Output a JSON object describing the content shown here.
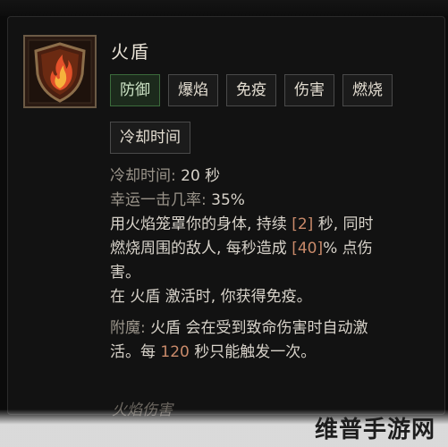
{
  "skill": {
    "name": "火盾",
    "tags": [
      "防御",
      "爆焰",
      "免疫",
      "伤害",
      "燃烧"
    ],
    "cooldown_tag": "冷却时间",
    "stats": {
      "cooldown_label": "冷却时间:",
      "cooldown_value": "20 秒",
      "lucky_label": "幸运一击几率:",
      "lucky_value": "35%"
    },
    "description": {
      "l1_a": "用火焰笼罩你的身体, 持续",
      "l1_b": "[2]",
      "l1_c": "秒, 同时",
      "l2_a": "燃烧周围的敌人, 每秒造成",
      "l2_b": "[40]",
      "l2_c": "% 点伤",
      "l3": "害。",
      "l4": "在 火盾 激活时, 你获得免疫。"
    },
    "enchant": {
      "label": "附魔:",
      "l1": "火盾 会在受到致命伤害时自动激",
      "l2_a": "活。每",
      "l2_b": "120",
      "l2_c": "秒只能触发一次。"
    },
    "footer": "火焰伤害"
  },
  "watermark": "维普手游网",
  "colors": {
    "panel": "#121212",
    "active_tag": "#1c2a1c",
    "highlight": "#c98a6a",
    "fire": "#e2502a"
  },
  "icons": {
    "skill": "flame-shield-icon"
  }
}
